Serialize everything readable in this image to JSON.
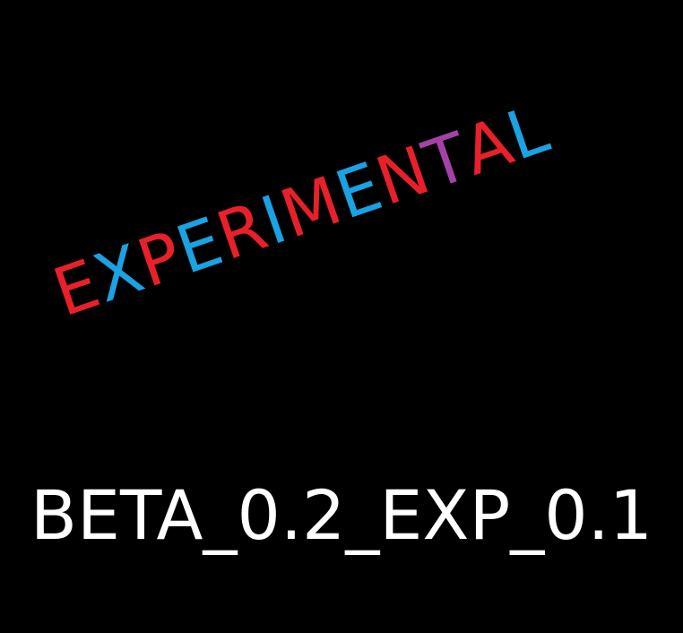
{
  "banner": {
    "word": "EXPERIMENTAL",
    "letters": [
      {
        "char": "E",
        "color": "#e8202a"
      },
      {
        "char": "X",
        "color": "#1aa2e3"
      },
      {
        "char": "P",
        "color": "#e8202a"
      },
      {
        "char": "E",
        "color": "#1aa2e3"
      },
      {
        "char": "R",
        "color": "#e8202a"
      },
      {
        "char": "I",
        "color": "#1aa2e3"
      },
      {
        "char": "M",
        "color": "#e8202a"
      },
      {
        "char": "E",
        "color": "#1aa2e3"
      },
      {
        "char": "N",
        "color": "#e8202a"
      },
      {
        "char": "T",
        "color": "#a542a8"
      },
      {
        "char": "A",
        "color": "#e8202a"
      },
      {
        "char": "L",
        "color": "#1aa2e3"
      }
    ],
    "version": "BETA_0.2_EXP_0.1"
  },
  "colors": {
    "background": "#000000",
    "version_text": "#ffffff"
  }
}
